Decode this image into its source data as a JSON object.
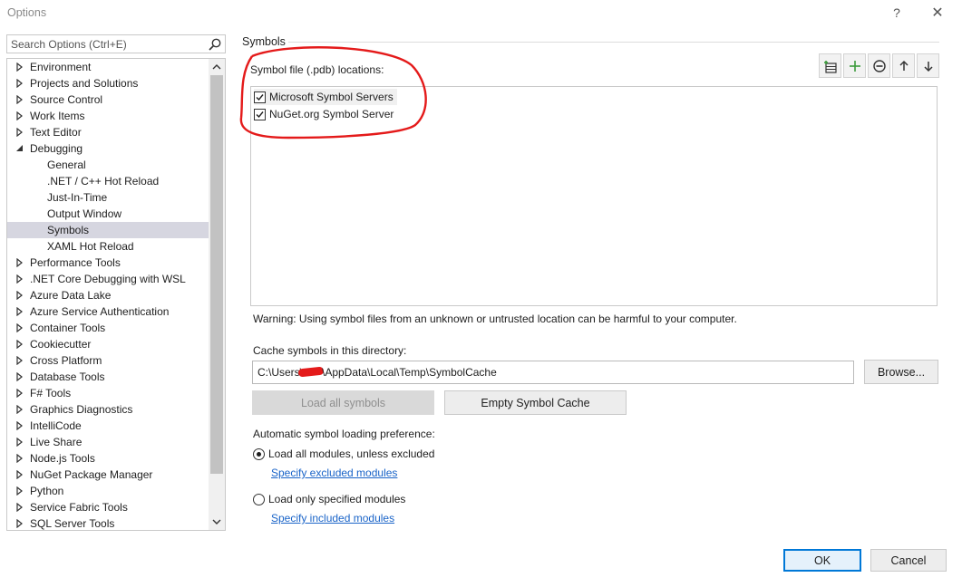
{
  "window": {
    "title": "Options",
    "help_glyph": "?",
    "close_glyph": "✕"
  },
  "search": {
    "placeholder": "Search Options (Ctrl+E)"
  },
  "tree": {
    "items": [
      {
        "label": "Environment",
        "level": 0,
        "expanded": false
      },
      {
        "label": "Projects and Solutions",
        "level": 0,
        "expanded": false
      },
      {
        "label": "Source Control",
        "level": 0,
        "expanded": false
      },
      {
        "label": "Work Items",
        "level": 0,
        "expanded": false
      },
      {
        "label": "Text Editor",
        "level": 0,
        "expanded": false
      },
      {
        "label": "Debugging",
        "level": 0,
        "expanded": true
      },
      {
        "label": "General",
        "level": 1
      },
      {
        "label": ".NET / C++ Hot Reload",
        "level": 1
      },
      {
        "label": "Just-In-Time",
        "level": 1
      },
      {
        "label": "Output Window",
        "level": 1
      },
      {
        "label": "Symbols",
        "level": 1,
        "selected": true
      },
      {
        "label": "XAML Hot Reload",
        "level": 1
      },
      {
        "label": "Performance Tools",
        "level": 0,
        "expanded": false
      },
      {
        "label": ".NET Core Debugging with WSL",
        "level": 0,
        "expanded": false
      },
      {
        "label": "Azure Data Lake",
        "level": 0,
        "expanded": false
      },
      {
        "label": "Azure Service Authentication",
        "level": 0,
        "expanded": false
      },
      {
        "label": "Container Tools",
        "level": 0,
        "expanded": false
      },
      {
        "label": "Cookiecutter",
        "level": 0,
        "expanded": false
      },
      {
        "label": "Cross Platform",
        "level": 0,
        "expanded": false
      },
      {
        "label": "Database Tools",
        "level": 0,
        "expanded": false
      },
      {
        "label": "F# Tools",
        "level": 0,
        "expanded": false
      },
      {
        "label": "Graphics Diagnostics",
        "level": 0,
        "expanded": false
      },
      {
        "label": "IntelliCode",
        "level": 0,
        "expanded": false
      },
      {
        "label": "Live Share",
        "level": 0,
        "expanded": false
      },
      {
        "label": "Node.js Tools",
        "level": 0,
        "expanded": false
      },
      {
        "label": "NuGet Package Manager",
        "level": 0,
        "expanded": false
      },
      {
        "label": "Python",
        "level": 0,
        "expanded": false
      },
      {
        "label": "Service Fabric Tools",
        "level": 0,
        "expanded": false
      },
      {
        "label": "SQL Server Tools",
        "level": 0,
        "expanded": false
      }
    ]
  },
  "symbols": {
    "section_title": "Symbols",
    "locations_label": "Symbol file (.pdb) locations:",
    "locations": [
      {
        "label": "Microsoft Symbol Servers",
        "checked": true
      },
      {
        "label": "NuGet.org Symbol Server",
        "checked": true
      }
    ],
    "warning": "Warning: Using symbol files from an unknown or untrusted location can be harmful to your computer.",
    "cache_label": "Cache symbols in this directory:",
    "cache_path_prefix": "C:\\Users\\",
    "cache_path_suffix": "\\AppData\\Local\\Temp\\SymbolCache",
    "browse_label": "Browse...",
    "load_all_label": "Load all symbols",
    "empty_cache_label": "Empty Symbol Cache",
    "auto_label": "Automatic symbol loading preference:",
    "option_all_label": "Load all modules, unless excluded",
    "option_all_selected": true,
    "link_excluded": "Specify excluded modules",
    "option_specified_label": "Load only specified modules",
    "link_included": "Specify included modules"
  },
  "footer": {
    "ok_label": "OK",
    "cancel_label": "Cancel"
  },
  "colors": {
    "accent": "#0078d7",
    "link": "#1a64c8",
    "annotation": "#e41a1a",
    "add_icon": "#3c9a3c"
  }
}
